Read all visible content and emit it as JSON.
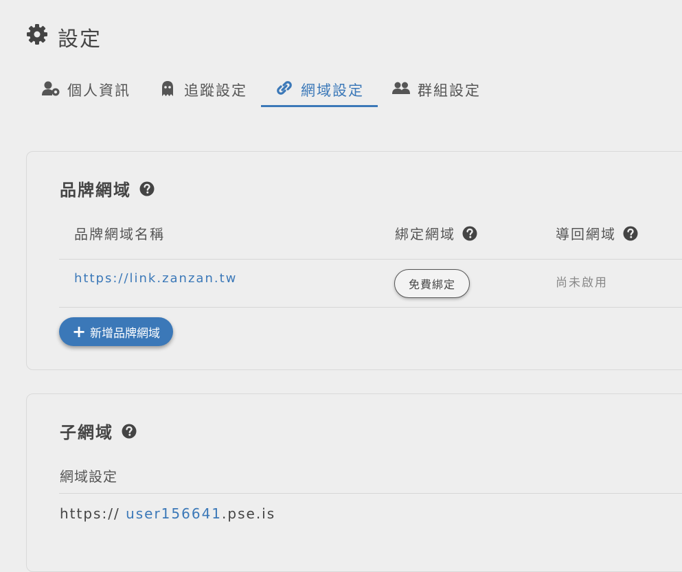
{
  "page": {
    "title": "設定"
  },
  "tabs": [
    {
      "label": "個人資訊",
      "icon": "user-gear-icon",
      "active": false
    },
    {
      "label": "追蹤設定",
      "icon": "ghost-icon",
      "active": false
    },
    {
      "label": "網域設定",
      "icon": "link-icon",
      "active": true
    },
    {
      "label": "群組設定",
      "icon": "users-icon",
      "active": false
    }
  ],
  "brand_domain": {
    "heading": "品牌網域",
    "columns": {
      "name": "品牌網域名稱",
      "bind": "綁定網域",
      "redirect": "導回網域"
    },
    "rows": [
      {
        "name": "https://link.zanzan.tw",
        "bind_button": "免費綁定",
        "redirect_status": "尚未啟用"
      }
    ],
    "add_button": "新增品牌網域"
  },
  "subdomain": {
    "heading": "子網域",
    "label": "網域設定",
    "prefix": "https://",
    "user": "user156641",
    "suffix": ".pse.is"
  },
  "colors": {
    "accent": "#3b78b8",
    "text": "#444444",
    "background": "#eeeeee"
  }
}
